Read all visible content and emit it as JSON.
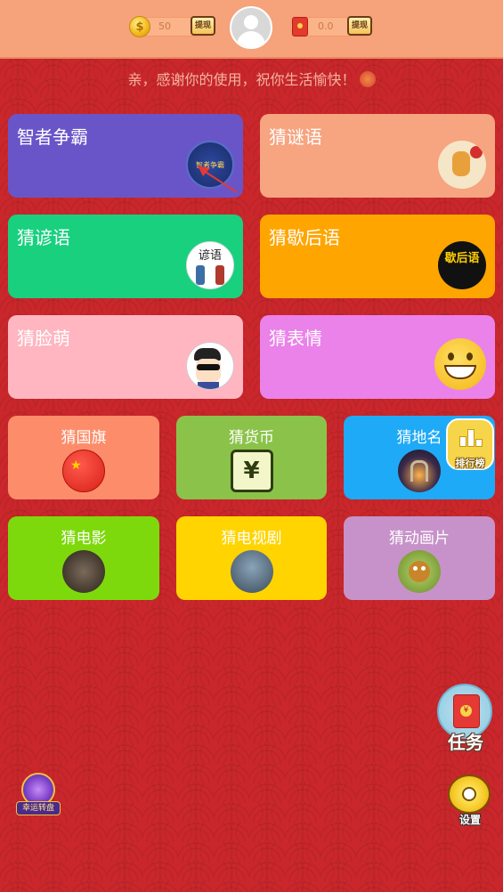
{
  "topbar": {
    "coins_value": "50",
    "coins_withdraw_label": "提现",
    "redpacket_value": "0.0",
    "redpacket_withdraw_label": "提现"
  },
  "greeting": "亲，感谢你的使用，祝你生活愉快！",
  "cards_large": [
    {
      "label": "智者争霸",
      "color": "#6a55c8",
      "thumb_text": "智者争霸"
    },
    {
      "label": "猜谜语",
      "color": "#f7a480"
    },
    {
      "label": "猜谚语",
      "color": "#19d07f",
      "thumb_text": "谚语"
    },
    {
      "label": "猜歇后语",
      "color": "#ffa500",
      "thumb_text": "歇后语"
    },
    {
      "label": "猜脸萌",
      "color": "#ffb6c1"
    },
    {
      "label": "猜表情",
      "color": "#ea82ea"
    }
  ],
  "cards_small": [
    {
      "label": "猜国旗",
      "color": "#fd8d6a"
    },
    {
      "label": "猜货币",
      "color": "#8bc34a",
      "thumb_text": "¥"
    },
    {
      "label": "猜地名",
      "color": "#1eaaf6"
    },
    {
      "label": "猜电影",
      "color": "#7ed90c"
    },
    {
      "label": "猜电视剧",
      "color": "#ffd400"
    },
    {
      "label": "猜动画片",
      "color": "#c792c9"
    }
  ],
  "rank_label": "排行榜",
  "task_label": "任务",
  "settings_label": "设置",
  "wheel_label": "幸运转盘"
}
